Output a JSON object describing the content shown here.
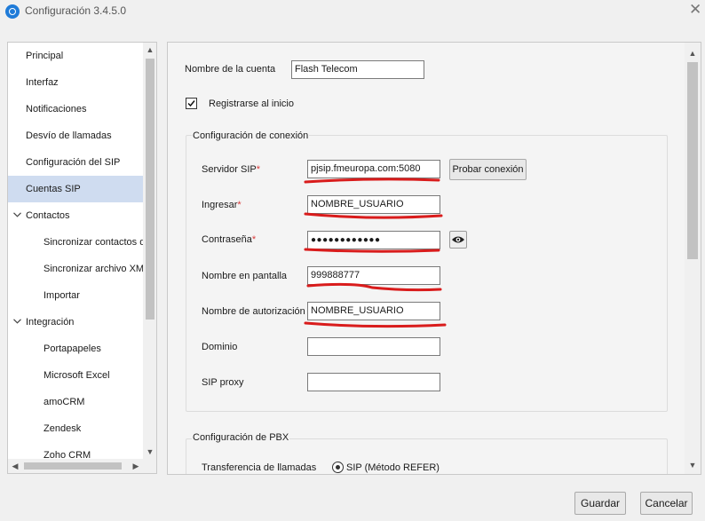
{
  "window": {
    "title": "Configuración 3.4.5.0",
    "close": "✕"
  },
  "nav": {
    "items": [
      {
        "label": "Principal"
      },
      {
        "label": "Interfaz"
      },
      {
        "label": "Notificaciones"
      },
      {
        "label": "Desvío de llamadas"
      },
      {
        "label": "Configuración del SIP"
      },
      {
        "label": "Cuentas SIP",
        "selected": true
      },
      {
        "label": "Contactos",
        "expanded": true
      },
      {
        "label": "Sincronizar contactos d"
      },
      {
        "label": "Sincronizar archivo XML"
      },
      {
        "label": "Importar"
      },
      {
        "label": "Integración",
        "expanded": true
      },
      {
        "label": "Portapapeles"
      },
      {
        "label": "Microsoft Excel"
      },
      {
        "label": "amoCRM"
      },
      {
        "label": "Zendesk"
      },
      {
        "label": "Zoho CRM"
      }
    ],
    "chevron": "❯"
  },
  "account": {
    "name_label": "Nombre de la cuenta",
    "name_value": "Flash Telecom",
    "register_label": "Registrarse al inicio",
    "register_checked": true
  },
  "connection": {
    "title": "Configuración de conexión",
    "server_label": "Servidor SIP",
    "server_value": "pjsip.fmeuropa.com:5080",
    "test_button": "Probar conexión",
    "login_label": "Ingresar",
    "login_value": "NOMBRE_USUARIO",
    "password_label": "Contraseña",
    "password_value": "●●●●●●●●●●●●",
    "display_label": "Nombre en pantalla",
    "display_value": "999888777",
    "auth_label": "Nombre de autorización",
    "auth_value": "NOMBRE_USUARIO",
    "domain_label": "Dominio",
    "domain_value": "",
    "proxy_label": "SIP proxy",
    "proxy_value": "",
    "required_mark": "*"
  },
  "pbx": {
    "title": "Configuración de PBX",
    "transfer_label": "Transferencia de llamadas",
    "transfer_option": "SIP (Método REFER)"
  },
  "footer": {
    "save": "Guardar",
    "cancel": "Cancelar"
  },
  "colors": {
    "selected": "#cfdcf0",
    "required": "#d83a3a",
    "annotation": "#d91c1c"
  }
}
